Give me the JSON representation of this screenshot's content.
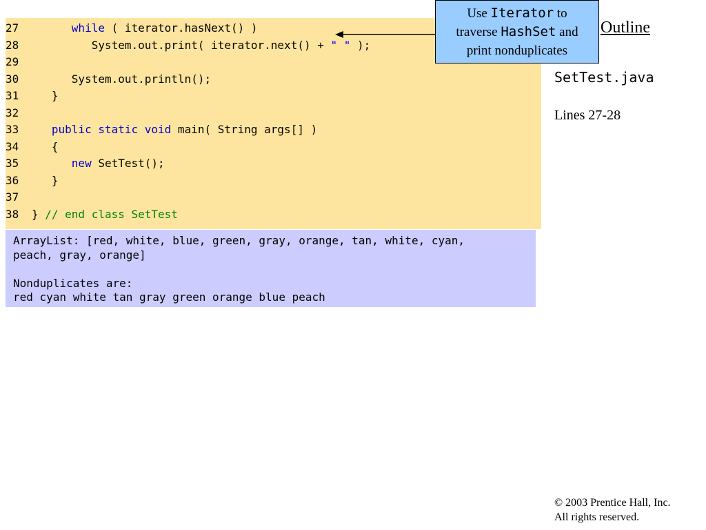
{
  "code_lines": [
    {
      "num": "27",
      "indent": "      ",
      "kw": "while",
      "rest": " ( iterator.hasNext() )"
    },
    {
      "num": "28",
      "indent": "         ",
      "pre": "System.out.print( iterator.next() + ",
      "str": "\" \"",
      "post": " );"
    },
    {
      "num": "29"
    },
    {
      "num": "30",
      "indent": "      ",
      "text": "System.out.println();"
    },
    {
      "num": "31",
      "indent": "   ",
      "text": "}"
    },
    {
      "num": "32"
    },
    {
      "num": "33",
      "indent": "   ",
      "kw": "public static void",
      "rest": " main( String args[] )"
    },
    {
      "num": "34",
      "indent": "   ",
      "text": "{"
    },
    {
      "num": "35",
      "indent": "      ",
      "kw": "new",
      "rest": " SetTest();"
    },
    {
      "num": "36",
      "indent": "   ",
      "text": "}"
    },
    {
      "num": "37"
    },
    {
      "num": "38",
      "indent": "",
      "pre": "} ",
      "comment": "// end class SetTest"
    }
  ],
  "output_lines": [
    "ArrayList: [red, white, blue, green, gray, orange, tan, white, cyan,",
    "peach, gray, orange]",
    "",
    "Nonduplicates are:",
    "red cyan white tan gray green orange blue peach"
  ],
  "callout": {
    "t1": "Use ",
    "c1": "Iterator",
    "t2": " to",
    "t3": "traverse ",
    "c2": "HashSet",
    "t4": " and",
    "t5": "print nonduplicates"
  },
  "sidebar": {
    "outline": "Outline",
    "file": "SetTest.java",
    "lines": "Lines 27-28"
  },
  "copyright": {
    "line1": "© 2003 Prentice Hall, Inc.",
    "line2": "All rights reserved."
  },
  "colors": {
    "code_bg": "#fee59f",
    "output_bg": "#ccccff",
    "callout_bg": "#99ccff",
    "keyword": "#0000cc",
    "comment": "#008000"
  }
}
